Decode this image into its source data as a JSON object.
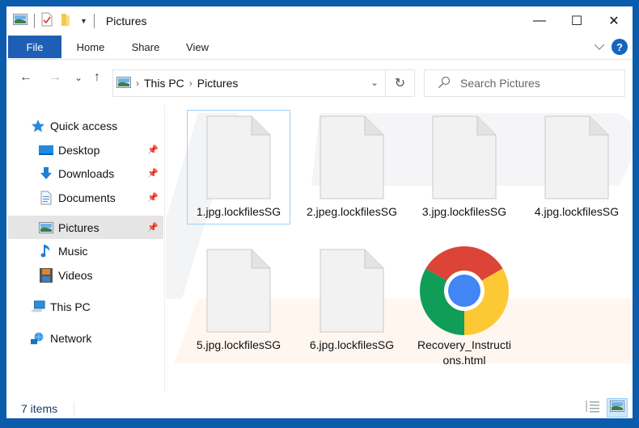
{
  "window": {
    "title": "Pictures",
    "controls": {
      "minimize": "—",
      "maximize": "☐",
      "close": "✕"
    }
  },
  "ribbon": {
    "tabs": [
      {
        "label": "File",
        "active": true
      },
      {
        "label": "Home"
      },
      {
        "label": "Share"
      },
      {
        "label": "View"
      }
    ],
    "help_label": "?",
    "expand_icon": "chevron-down"
  },
  "navigation": {
    "back": "←",
    "forward": "→",
    "recent": "⌄",
    "up": "↑",
    "breadcrumb": [
      "This PC",
      "Pictures"
    ],
    "separator": "›",
    "dropdown": "⌄",
    "refresh": "↻"
  },
  "search": {
    "placeholder": "Search Pictures",
    "value": ""
  },
  "sidebar": {
    "items": [
      {
        "label": "Quick access",
        "icon": "star-icon"
      },
      {
        "label": "Desktop",
        "icon": "desktop-icon",
        "pinned": true
      },
      {
        "label": "Downloads",
        "icon": "download-icon",
        "pinned": true
      },
      {
        "label": "Documents",
        "icon": "documents-icon",
        "pinned": true
      },
      {
        "label": "Pictures",
        "icon": "pictures-icon",
        "pinned": true,
        "selected": true
      },
      {
        "label": "Music",
        "icon": "music-icon"
      },
      {
        "label": "Videos",
        "icon": "videos-icon"
      },
      {
        "label": "This PC",
        "icon": "computer-icon"
      },
      {
        "label": "Network",
        "icon": "network-icon"
      }
    ]
  },
  "files": [
    {
      "name": "1.jpg.lockfilesSG",
      "type": "blank",
      "selected": true
    },
    {
      "name": "2.jpeg.lockfilesSG",
      "type": "blank"
    },
    {
      "name": "3.jpg.lockfilesSG",
      "type": "blank"
    },
    {
      "name": "4.jpg.lockfilesSG",
      "type": "blank"
    },
    {
      "name": "5.jpg.lockfilesSG",
      "type": "blank"
    },
    {
      "name": "6.jpg.lockfilesSG",
      "type": "blank"
    },
    {
      "name": "Recovery_Instructions.html",
      "type": "chrome-html"
    }
  ],
  "status": {
    "item_count": "7 items",
    "view_modes": [
      "details",
      "large-icons"
    ],
    "active_view": "large-icons"
  },
  "colors": {
    "accent": "#1e5fb5",
    "frame": "#0b5cad",
    "selection": "#cce8ff",
    "selection_border": "#99d1ff"
  }
}
